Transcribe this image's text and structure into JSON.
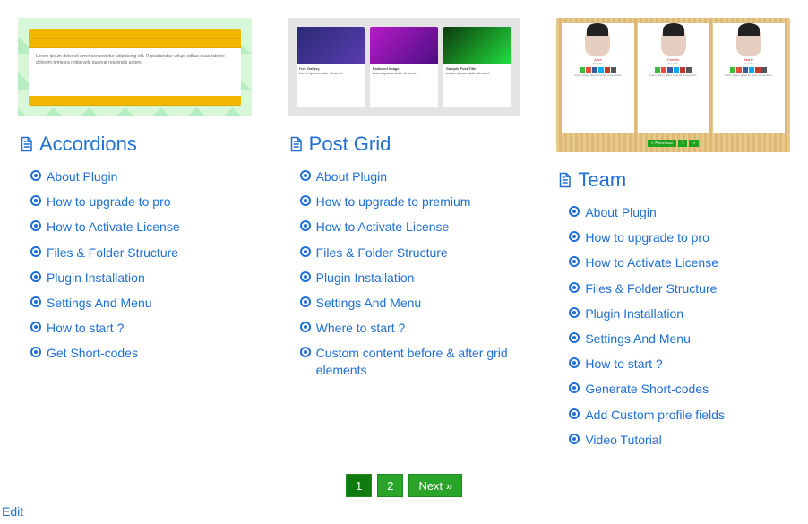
{
  "cards": [
    {
      "id": "accordions",
      "title": "Accordions",
      "links": [
        "About Plugin",
        "How to upgrade to pro",
        "How to Activate License",
        "Files & Folder Structure",
        "Plugin Installation",
        "Settings And Menu",
        "How to start ?",
        "Get Short-codes"
      ]
    },
    {
      "id": "post-grid",
      "title": "Post Grid",
      "links": [
        "About Plugin",
        "How to upgrade to premium",
        "How to Activate License",
        "Files & Folder Structure",
        "Plugin Installation",
        "Settings And Menu",
        "Where to start ?",
        "Custom content before & after grid elements"
      ]
    },
    {
      "id": "team",
      "title": "Team",
      "links": [
        "About Plugin",
        "How to upgrade to pro",
        "How to Activate License",
        "Files & Folder Structure",
        "Plugin Installation",
        "Settings And Menu",
        "How to start ?",
        "Generate Short-codes",
        "Add Custom profile fields",
        "Video Tutorial"
      ]
    }
  ],
  "pagination": {
    "pages": [
      "1",
      "2"
    ],
    "current": "1",
    "next_label": "Next »"
  },
  "edit_label": "Edit"
}
